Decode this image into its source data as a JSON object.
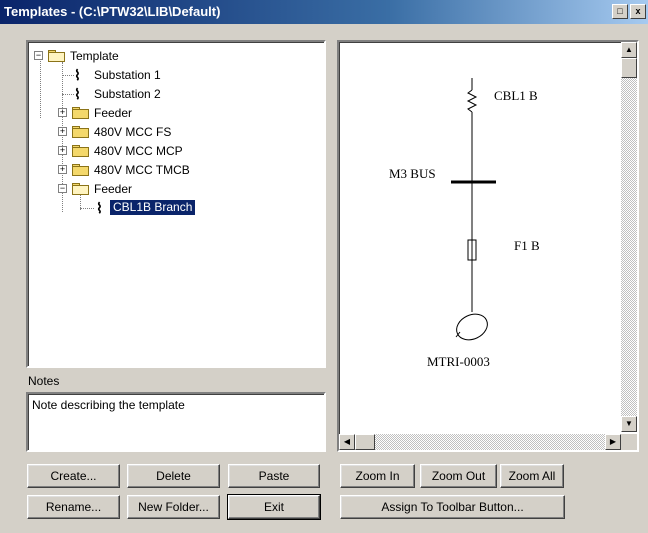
{
  "window": {
    "title": "Templates - (C:\\PTW32\\LIB\\Default)",
    "restore_glyph": "□",
    "close_glyph": "x"
  },
  "tree": {
    "items": [
      {
        "label": "Template",
        "icon": "folder-open-icon",
        "expander": "−"
      },
      {
        "label": "Substation 1",
        "icon": "template-leaf-icon"
      },
      {
        "label": "Substation 2",
        "icon": "template-leaf-icon"
      },
      {
        "label": "Feeder",
        "icon": "folder-icon",
        "expander": "+"
      },
      {
        "label": "480V MCC FS",
        "icon": "folder-icon",
        "expander": "+"
      },
      {
        "label": "480V MCC MCP",
        "icon": "folder-icon",
        "expander": "+"
      },
      {
        "label": "480V MCC TMCB",
        "icon": "folder-icon",
        "expander": "+"
      },
      {
        "label": "Feeder",
        "icon": "folder-icon",
        "expander": "−"
      },
      {
        "label": "CBL1B Branch",
        "icon": "template-leaf-icon",
        "selected": true
      }
    ],
    "leaf_glyph": "⌇"
  },
  "notes": {
    "label": "Notes",
    "value": "Note describing the template"
  },
  "diagram": {
    "cable_label": "CBL1 B",
    "bus_label": "M3 BUS",
    "fuse_label": "F1 B",
    "motor_label": "MTRI-0003"
  },
  "scrollbars": {
    "up": "▲",
    "down": "▼",
    "left": "◀",
    "right": "▶"
  },
  "buttons": {
    "create": "Create...",
    "delete": "Delete",
    "paste": "Paste",
    "rename": "Rename...",
    "new_folder": "New Folder...",
    "exit": "Exit",
    "zoom_in": "Zoom In",
    "zoom_out": "Zoom Out",
    "zoom_all": "Zoom All",
    "assign_toolbar": "Assign To Toolbar Button..."
  },
  "colors": {
    "title_active": "#0a246a",
    "selection": "#0a246a",
    "face": "#d4d0c8"
  }
}
